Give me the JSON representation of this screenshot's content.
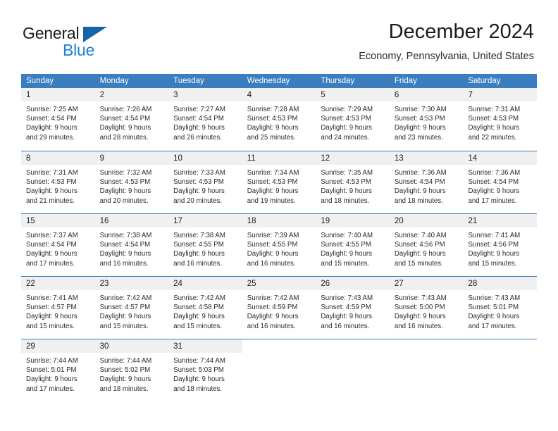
{
  "brand": {
    "name_part1": "General",
    "name_part2": "Blue",
    "accent_color": "#1a7fd4",
    "triangle_color": "#1464aa"
  },
  "header": {
    "title": "December 2024",
    "subtitle": "Economy, Pennsylvania, United States"
  },
  "calendar": {
    "header_bg": "#3a7ebf",
    "day_band_bg": "#f0f0f0",
    "weekdays": [
      "Sunday",
      "Monday",
      "Tuesday",
      "Wednesday",
      "Thursday",
      "Friday",
      "Saturday"
    ],
    "weeks": [
      [
        {
          "day": "1",
          "sunrise": "Sunrise: 7:25 AM",
          "sunset": "Sunset: 4:54 PM",
          "daylight1": "Daylight: 9 hours",
          "daylight2": "and 29 minutes."
        },
        {
          "day": "2",
          "sunrise": "Sunrise: 7:26 AM",
          "sunset": "Sunset: 4:54 PM",
          "daylight1": "Daylight: 9 hours",
          "daylight2": "and 28 minutes."
        },
        {
          "day": "3",
          "sunrise": "Sunrise: 7:27 AM",
          "sunset": "Sunset: 4:54 PM",
          "daylight1": "Daylight: 9 hours",
          "daylight2": "and 26 minutes."
        },
        {
          "day": "4",
          "sunrise": "Sunrise: 7:28 AM",
          "sunset": "Sunset: 4:53 PM",
          "daylight1": "Daylight: 9 hours",
          "daylight2": "and 25 minutes."
        },
        {
          "day": "5",
          "sunrise": "Sunrise: 7:29 AM",
          "sunset": "Sunset: 4:53 PM",
          "daylight1": "Daylight: 9 hours",
          "daylight2": "and 24 minutes."
        },
        {
          "day": "6",
          "sunrise": "Sunrise: 7:30 AM",
          "sunset": "Sunset: 4:53 PM",
          "daylight1": "Daylight: 9 hours",
          "daylight2": "and 23 minutes."
        },
        {
          "day": "7",
          "sunrise": "Sunrise: 7:31 AM",
          "sunset": "Sunset: 4:53 PM",
          "daylight1": "Daylight: 9 hours",
          "daylight2": "and 22 minutes."
        }
      ],
      [
        {
          "day": "8",
          "sunrise": "Sunrise: 7:31 AM",
          "sunset": "Sunset: 4:53 PM",
          "daylight1": "Daylight: 9 hours",
          "daylight2": "and 21 minutes."
        },
        {
          "day": "9",
          "sunrise": "Sunrise: 7:32 AM",
          "sunset": "Sunset: 4:53 PM",
          "daylight1": "Daylight: 9 hours",
          "daylight2": "and 20 minutes."
        },
        {
          "day": "10",
          "sunrise": "Sunrise: 7:33 AM",
          "sunset": "Sunset: 4:53 PM",
          "daylight1": "Daylight: 9 hours",
          "daylight2": "and 20 minutes."
        },
        {
          "day": "11",
          "sunrise": "Sunrise: 7:34 AM",
          "sunset": "Sunset: 4:53 PM",
          "daylight1": "Daylight: 9 hours",
          "daylight2": "and 19 minutes."
        },
        {
          "day": "12",
          "sunrise": "Sunrise: 7:35 AM",
          "sunset": "Sunset: 4:53 PM",
          "daylight1": "Daylight: 9 hours",
          "daylight2": "and 18 minutes."
        },
        {
          "day": "13",
          "sunrise": "Sunrise: 7:36 AM",
          "sunset": "Sunset: 4:54 PM",
          "daylight1": "Daylight: 9 hours",
          "daylight2": "and 18 minutes."
        },
        {
          "day": "14",
          "sunrise": "Sunrise: 7:36 AM",
          "sunset": "Sunset: 4:54 PM",
          "daylight1": "Daylight: 9 hours",
          "daylight2": "and 17 minutes."
        }
      ],
      [
        {
          "day": "15",
          "sunrise": "Sunrise: 7:37 AM",
          "sunset": "Sunset: 4:54 PM",
          "daylight1": "Daylight: 9 hours",
          "daylight2": "and 17 minutes."
        },
        {
          "day": "16",
          "sunrise": "Sunrise: 7:38 AM",
          "sunset": "Sunset: 4:54 PM",
          "daylight1": "Daylight: 9 hours",
          "daylight2": "and 16 minutes."
        },
        {
          "day": "17",
          "sunrise": "Sunrise: 7:38 AM",
          "sunset": "Sunset: 4:55 PM",
          "daylight1": "Daylight: 9 hours",
          "daylight2": "and 16 minutes."
        },
        {
          "day": "18",
          "sunrise": "Sunrise: 7:39 AM",
          "sunset": "Sunset: 4:55 PM",
          "daylight1": "Daylight: 9 hours",
          "daylight2": "and 16 minutes."
        },
        {
          "day": "19",
          "sunrise": "Sunrise: 7:40 AM",
          "sunset": "Sunset: 4:55 PM",
          "daylight1": "Daylight: 9 hours",
          "daylight2": "and 15 minutes."
        },
        {
          "day": "20",
          "sunrise": "Sunrise: 7:40 AM",
          "sunset": "Sunset: 4:56 PM",
          "daylight1": "Daylight: 9 hours",
          "daylight2": "and 15 minutes."
        },
        {
          "day": "21",
          "sunrise": "Sunrise: 7:41 AM",
          "sunset": "Sunset: 4:56 PM",
          "daylight1": "Daylight: 9 hours",
          "daylight2": "and 15 minutes."
        }
      ],
      [
        {
          "day": "22",
          "sunrise": "Sunrise: 7:41 AM",
          "sunset": "Sunset: 4:57 PM",
          "daylight1": "Daylight: 9 hours",
          "daylight2": "and 15 minutes."
        },
        {
          "day": "23",
          "sunrise": "Sunrise: 7:42 AM",
          "sunset": "Sunset: 4:57 PM",
          "daylight1": "Daylight: 9 hours",
          "daylight2": "and 15 minutes."
        },
        {
          "day": "24",
          "sunrise": "Sunrise: 7:42 AM",
          "sunset": "Sunset: 4:58 PM",
          "daylight1": "Daylight: 9 hours",
          "daylight2": "and 15 minutes."
        },
        {
          "day": "25",
          "sunrise": "Sunrise: 7:42 AM",
          "sunset": "Sunset: 4:59 PM",
          "daylight1": "Daylight: 9 hours",
          "daylight2": "and 16 minutes."
        },
        {
          "day": "26",
          "sunrise": "Sunrise: 7:43 AM",
          "sunset": "Sunset: 4:59 PM",
          "daylight1": "Daylight: 9 hours",
          "daylight2": "and 16 minutes."
        },
        {
          "day": "27",
          "sunrise": "Sunrise: 7:43 AM",
          "sunset": "Sunset: 5:00 PM",
          "daylight1": "Daylight: 9 hours",
          "daylight2": "and 16 minutes."
        },
        {
          "day": "28",
          "sunrise": "Sunrise: 7:43 AM",
          "sunset": "Sunset: 5:01 PM",
          "daylight1": "Daylight: 9 hours",
          "daylight2": "and 17 minutes."
        }
      ],
      [
        {
          "day": "29",
          "sunrise": "Sunrise: 7:44 AM",
          "sunset": "Sunset: 5:01 PM",
          "daylight1": "Daylight: 9 hours",
          "daylight2": "and 17 minutes."
        },
        {
          "day": "30",
          "sunrise": "Sunrise: 7:44 AM",
          "sunset": "Sunset: 5:02 PM",
          "daylight1": "Daylight: 9 hours",
          "daylight2": "and 18 minutes."
        },
        {
          "day": "31",
          "sunrise": "Sunrise: 7:44 AM",
          "sunset": "Sunset: 5:03 PM",
          "daylight1": "Daylight: 9 hours",
          "daylight2": "and 18 minutes."
        },
        {
          "day": "",
          "sunrise": "",
          "sunset": "",
          "daylight1": "",
          "daylight2": ""
        },
        {
          "day": "",
          "sunrise": "",
          "sunset": "",
          "daylight1": "",
          "daylight2": ""
        },
        {
          "day": "",
          "sunrise": "",
          "sunset": "",
          "daylight1": "",
          "daylight2": ""
        },
        {
          "day": "",
          "sunrise": "",
          "sunset": "",
          "daylight1": "",
          "daylight2": ""
        }
      ]
    ]
  }
}
